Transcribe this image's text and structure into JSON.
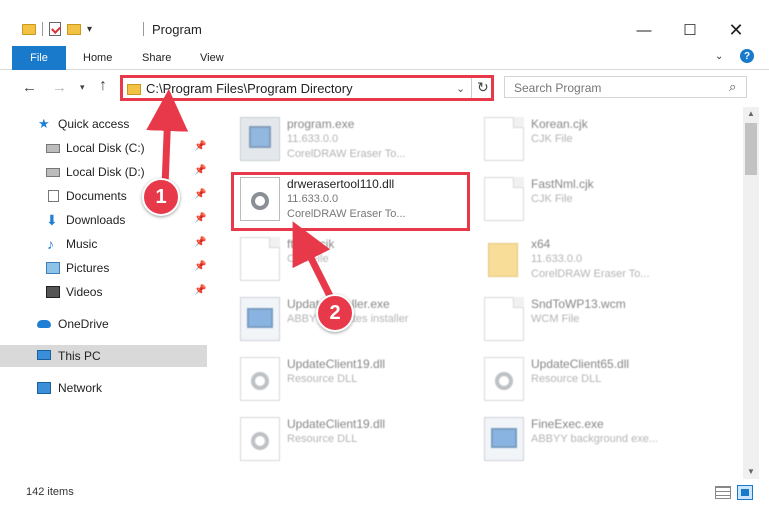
{
  "window": {
    "title": "Program",
    "min_glyph": "—",
    "max_glyph": "☐",
    "close_glyph": "✕"
  },
  "ribbon": {
    "tabs": [
      "File",
      "Home",
      "Share",
      "View"
    ],
    "help_label": "?"
  },
  "address": {
    "path": "C:\\Program Files\\Program Directory",
    "search_placeholder": "Search Program"
  },
  "sidebar": {
    "items": [
      {
        "label": "Quick access",
        "icon": "star-icon",
        "pinned": false
      },
      {
        "label": "Local Disk (C:)",
        "icon": "disk-icon",
        "pinned": true
      },
      {
        "label": "Local Disk (D:)",
        "icon": "disk-icon",
        "pinned": true
      },
      {
        "label": "Documents",
        "icon": "documents-icon",
        "pinned": true
      },
      {
        "label": "Downloads",
        "icon": "download-icon",
        "pinned": true
      },
      {
        "label": "Music",
        "icon": "music-icon",
        "pinned": true
      },
      {
        "label": "Pictures",
        "icon": "pictures-icon",
        "pinned": true
      },
      {
        "label": "Videos",
        "icon": "videos-icon",
        "pinned": true
      },
      {
        "label": "OneDrive",
        "icon": "cloud-icon",
        "pinned": false
      },
      {
        "label": "This PC",
        "icon": "computer-icon",
        "pinned": false,
        "selected": true
      },
      {
        "label": "Network",
        "icon": "network-icon",
        "pinned": false
      }
    ]
  },
  "files": [
    {
      "name": "program.exe",
      "line2": "11.633.0.0",
      "line3": "CorelDRAW Eraser To...",
      "icon": "program-icon"
    },
    {
      "name": "Korean.cjk",
      "line2": "CJK File",
      "line3": "",
      "icon": "document-icon"
    },
    {
      "name": "drwerasertool110.dll",
      "line2": "11.633.0.0",
      "line3": "CorelDRAW Eraser To...",
      "icon": "dll-gear-icon",
      "highlighted": true
    },
    {
      "name": "FastNml.cjk",
      "line2": "CJK File",
      "line3": "",
      "icon": "document-icon"
    },
    {
      "name": "ftcom.cjk",
      "line2": "CJK File",
      "line3": "",
      "icon": "document-icon"
    },
    {
      "name": "x64",
      "line2": "11.633.0.0",
      "line3": "CorelDRAW Eraser To...",
      "icon": "folder-icon"
    },
    {
      "name": "UpdateInstaller.exe",
      "line2": "ABBYY Updates installer",
      "line3": "",
      "icon": "installer-icon"
    },
    {
      "name": "SndToWP13.wcm",
      "line2": "WCM File",
      "line3": "",
      "icon": "document-icon"
    },
    {
      "name": "UpdateClient19.dll",
      "line2": "Resource DLL",
      "line3": "",
      "icon": "dll-gear-icon"
    },
    {
      "name": "UpdateClient65.dll",
      "line2": "Resource DLL",
      "line3": "",
      "icon": "dll-gear-icon"
    },
    {
      "name": "UpdateClient19.dll",
      "line2": "Resource DLL",
      "line3": "",
      "icon": "dll-gear-icon"
    },
    {
      "name": "FineExec.exe",
      "line2": "ABBYY background exe...",
      "line3": "",
      "icon": "program-icon"
    }
  ],
  "status": {
    "item_count": "142 items"
  },
  "callouts": {
    "first": "1",
    "second": "2"
  },
  "colors": {
    "accent": "#1979ca",
    "highlight": "#e8394a"
  }
}
